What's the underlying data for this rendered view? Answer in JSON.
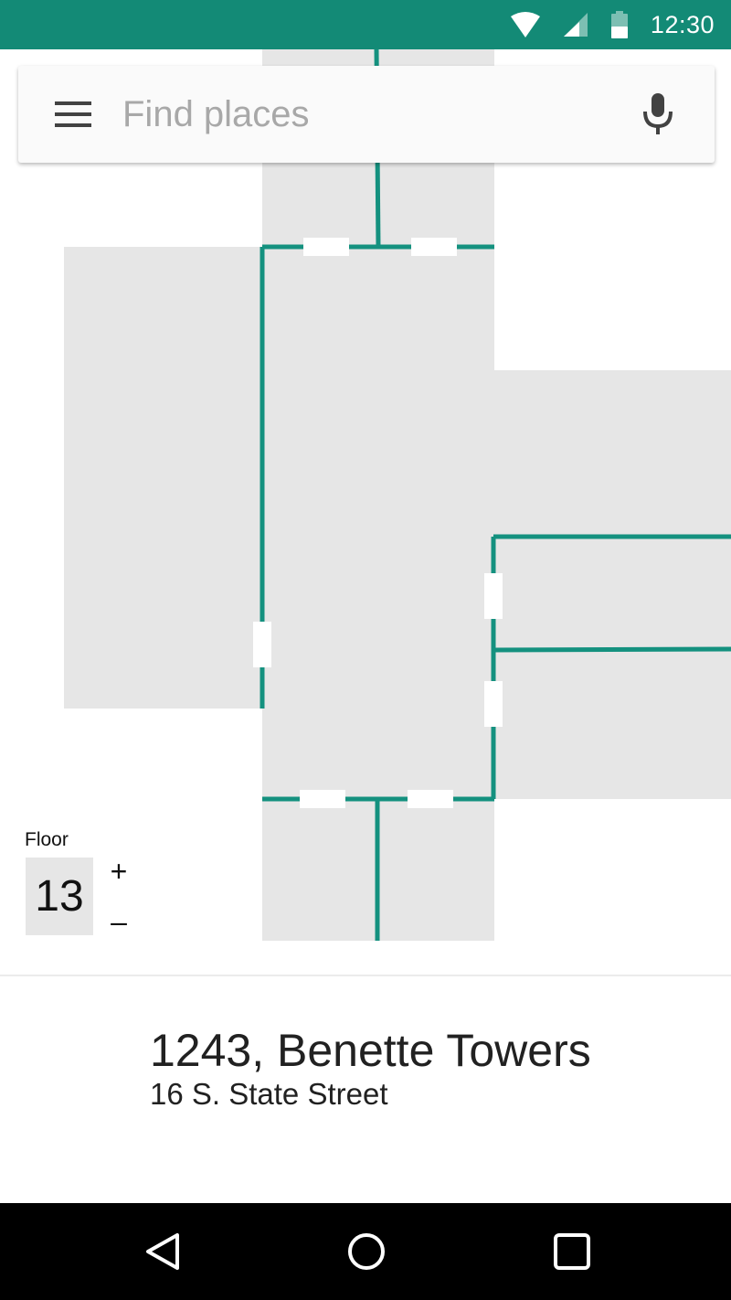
{
  "status_bar": {
    "time": "12:30",
    "icons": [
      "wifi-icon",
      "cell-signal-icon",
      "battery-icon"
    ],
    "background": "#138a76"
  },
  "search": {
    "placeholder": "Find places",
    "value": "",
    "menu_icon": "menu-icon",
    "mic_icon": "mic-icon"
  },
  "map": {
    "room_color": "#e6e6e6",
    "wall_color": "#14917f",
    "door_color": "#ffffff"
  },
  "floor_selector": {
    "label": "Floor",
    "current": "13",
    "increment": "+",
    "decrement": "–"
  },
  "place": {
    "title": "1243, Benette Towers",
    "address": "16 S. State Street"
  },
  "nav_bar": {
    "items": [
      "back-icon",
      "home-icon",
      "recents-icon"
    ]
  }
}
